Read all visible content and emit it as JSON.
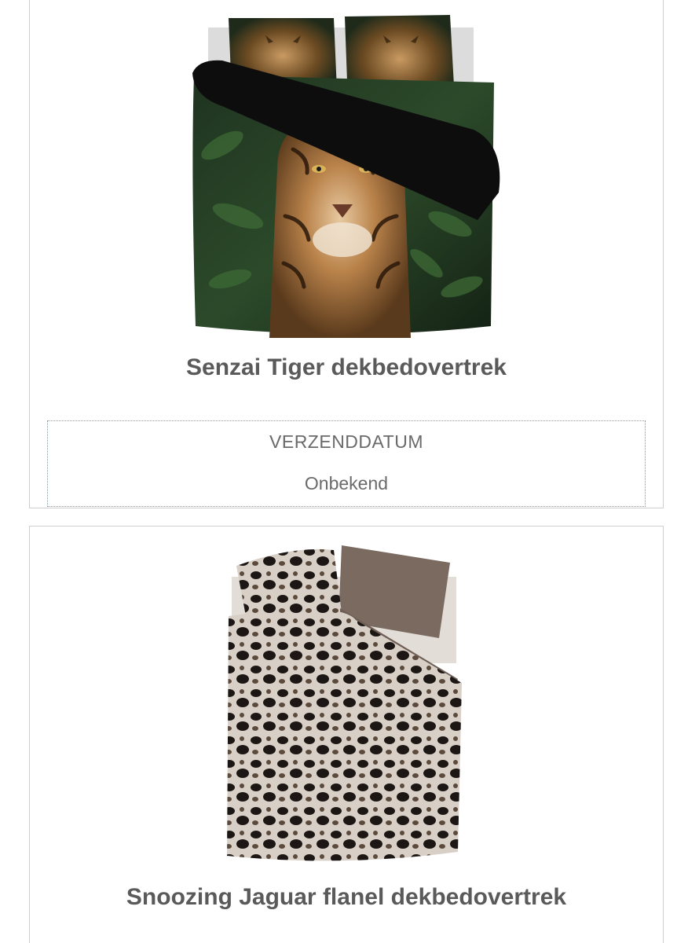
{
  "products": [
    {
      "title": "Senzai Tiger dekbedovertrek",
      "image_icon": "tiger-duvet-image",
      "shipping": {
        "label": "VERZENDDATUM",
        "value": "Onbekend"
      }
    },
    {
      "title": "Snoozing Jaguar flanel dekbedovertrek",
      "image_icon": "jaguar-duvet-image"
    }
  ],
  "colors": {
    "title_text": "#5a5a5a",
    "card_border": "#cfcfcf",
    "ship_box_border": "#7f9cab"
  }
}
